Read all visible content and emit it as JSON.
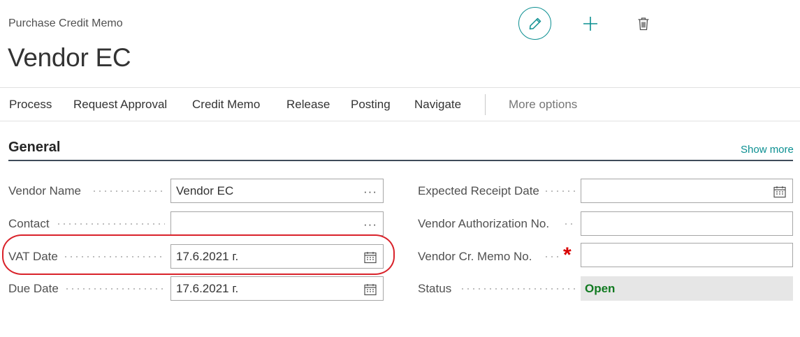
{
  "header": {
    "page_type": "Purchase Credit Memo",
    "title": "Vendor EC"
  },
  "toolbar": {
    "edit_icon": "pencil-icon",
    "new_icon": "plus-icon",
    "delete_icon": "trash-icon"
  },
  "actions": {
    "items": [
      "Process",
      "Request Approval",
      "Credit Memo",
      "Release",
      "Posting",
      "Navigate"
    ],
    "more": "More options"
  },
  "section": {
    "title": "General",
    "show_more": "Show more"
  },
  "fields": {
    "vendor_name": {
      "label": "Vendor Name",
      "value": "Vendor EC"
    },
    "contact": {
      "label": "Contact",
      "value": ""
    },
    "vat_date": {
      "label": "VAT Date",
      "value": "17.6.2021 г."
    },
    "due_date": {
      "label": "Due Date",
      "value": "17.6.2021 г."
    },
    "expected_receipt_date": {
      "label": "Expected Receipt Date",
      "value": ""
    },
    "vendor_authorization_no": {
      "label": "Vendor Authorization No.",
      "value": ""
    },
    "vendor_cr_memo_no": {
      "label": "Vendor Cr. Memo No.",
      "value": "",
      "required_mark": "*"
    },
    "status": {
      "label": "Status",
      "value": "Open"
    }
  },
  "colors": {
    "accent": "#0b8f91",
    "status_open": "#117a21",
    "required": "#d80000",
    "highlight": "#d9222a"
  }
}
